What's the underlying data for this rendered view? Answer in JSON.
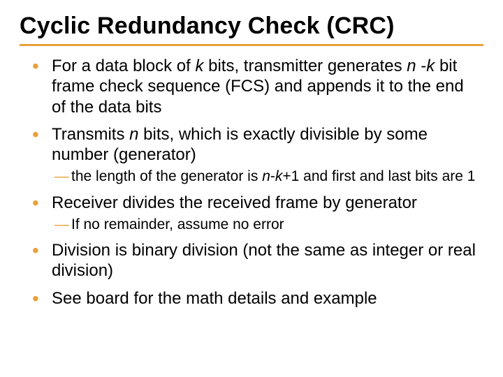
{
  "title": "Cyclic Redundancy Check (CRC)",
  "bullets": {
    "b1": {
      "p1": "For a data block of ",
      "k1": "k",
      "p2": " bits, transmitter generates ",
      "n1": "n",
      "p3": " -",
      "k2": "k",
      "p4": " bit frame check sequence (FCS) and appends it to the end of the data bits"
    },
    "b2": {
      "p1": "Transmits ",
      "n1": "n",
      "p2": " bits, which is exactly divisible by some number (generator)"
    },
    "b2s1": {
      "p1": "the length of the generator is ",
      "n1": "n",
      "p2": "-",
      "k1": "k",
      "p3": "+1 and first and last bits are 1"
    },
    "b3": "Receiver divides the received frame by generator",
    "b3s1": "If no remainder, assume no error",
    "b4": "Division is binary division (not the same as integer or real division)",
    "b5": "See board for the math details and example"
  }
}
